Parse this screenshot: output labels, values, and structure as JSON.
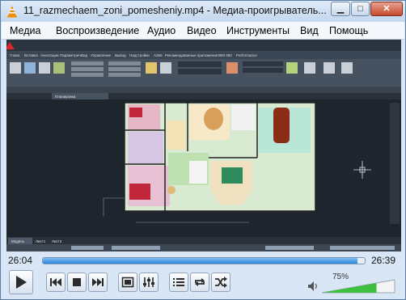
{
  "window": {
    "title": "11_razmechaem_zoni_pomesheniy.mp4 - Медиа-проигрыватель...",
    "minimize_glyph": "▁",
    "maximize_glyph": "□",
    "close_glyph": "✕"
  },
  "menu": {
    "items": [
      "Медиа",
      "Воспроизведение",
      "Аудио",
      "Видео",
      "Инструменты",
      "Вид",
      "Помощь"
    ]
  },
  "video": {
    "app_menu_items": [
      "Главн.",
      "Вставка",
      "Аннотации",
      "Параметрич.",
      "Вид",
      "Управление",
      "Вывод",
      "Надстройки",
      "A360",
      "Рекомендованные приложения",
      "BIM 360",
      "Performance"
    ],
    "viewport_label": "[-][Сверху][2D-каркас]",
    "doc_tab_label": "Планировка",
    "layout_tabs": [
      "Модель",
      "Лист1",
      "Лист2"
    ],
    "tool_groups": [
      "Рисование",
      "Редактирование",
      "Аннотации",
      "Слои",
      "Блок",
      "Свойства",
      "Группы",
      "Утилиты",
      "Буфер"
    ]
  },
  "playback": {
    "elapsed": "26:04",
    "total": "26:39",
    "progress": 0.978
  },
  "volume": {
    "label": "75%",
    "level": 0.75
  },
  "icons": {
    "app": "vlc-cone-icon",
    "play": "play-icon",
    "previous": "skip-previous-icon",
    "stop": "stop-icon",
    "next": "skip-next-icon",
    "fullscreen": "fullscreen-icon",
    "equalizer": "extended-settings-icon",
    "playlist": "playlist-icon",
    "loop": "loop-icon",
    "shuffle": "shuffle-icon",
    "speaker": "speaker-icon"
  },
  "colors": {
    "accent": "#2b86dd",
    "volume": "#3fbf3f",
    "vlc_orange": "#f08c00"
  }
}
